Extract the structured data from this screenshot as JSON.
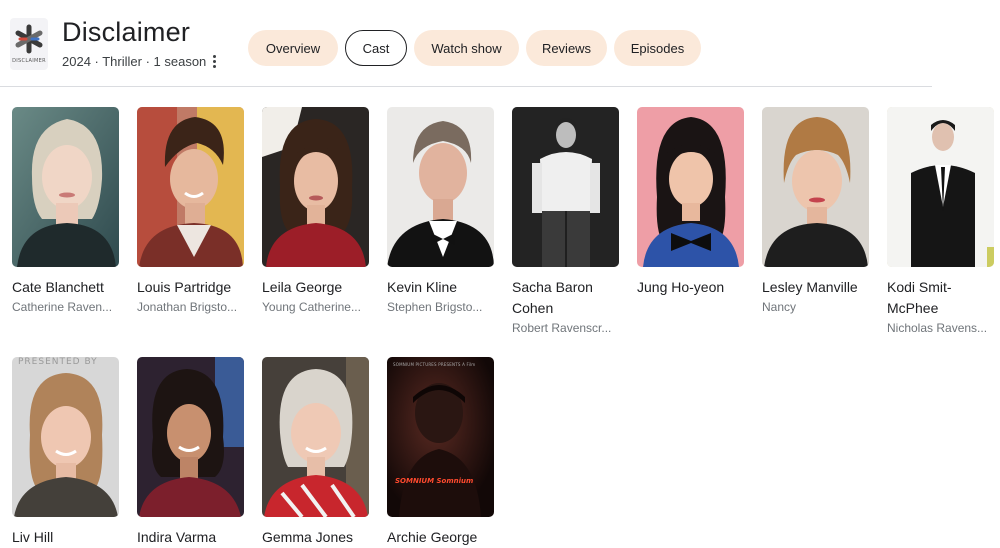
{
  "show": {
    "title": "Disclaimer",
    "meta": "2024 · Thriller · 1 season",
    "logo_icon": "asterisk-logo",
    "logo_text": "DISCLAIMER"
  },
  "tabs": [
    {
      "label": "Overview",
      "active": false
    },
    {
      "label": "Cast",
      "active": true
    },
    {
      "label": "Watch show",
      "active": false
    },
    {
      "label": "Reviews",
      "active": false
    },
    {
      "label": "Episodes",
      "active": false
    }
  ],
  "colors": {
    "tab_bg": "#fbe9da",
    "accent_text": "#202124",
    "secondary_text": "#70757a",
    "divider": "#dadce0"
  },
  "cast": [
    {
      "name": "Cate Blanchett",
      "role": "Catherine Raven..."
    },
    {
      "name": "Louis Partridge",
      "role": "Jonathan Brigsto..."
    },
    {
      "name": "Leila George",
      "role": "Young Catherine..."
    },
    {
      "name": "Kevin Kline",
      "role": "Stephen Brigsto..."
    },
    {
      "name": "Sacha Baron Cohen",
      "role": "Robert Ravenscr..."
    },
    {
      "name": "Jung Ho-yeon",
      "role": ""
    },
    {
      "name": "Lesley Manville",
      "role": "Nancy"
    },
    {
      "name": "Kodi Smit-McPhee",
      "role": "Nicholas Ravens..."
    },
    {
      "name": "Liv Hill",
      "role": ""
    },
    {
      "name": "Indira Varma",
      "role": ""
    },
    {
      "name": "Gemma Jones",
      "role": ""
    },
    {
      "name": "Archie George",
      "role": ""
    }
  ],
  "photo_overlays": {
    "liv_hill_backdrop": "PRESENTED BY",
    "archie_poster_top": "SOMNIUM PICTURES PRESENTS  A  Film",
    "archie_poster_title": "SOMNIUM Somnium"
  }
}
